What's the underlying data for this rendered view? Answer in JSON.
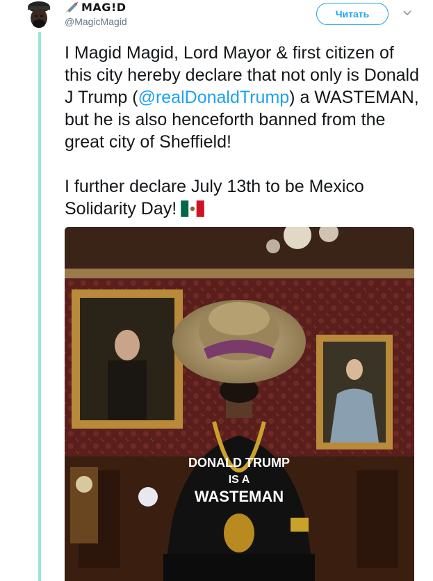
{
  "tweet": {
    "display_name": "MAG!D",
    "handle": "@MagicMagid",
    "follow_label": "Читать",
    "text_before_mention": "I Magid Magid, Lord Mayor & first citizen of this city hereby declare that not only is Donald J Trump (",
    "mention": "@realDonaldTrump",
    "text_after_mention": ") a WASTEMAN, but he is also henceforth banned from the great city of Sheffield!",
    "paragraph2": "I further declare July 13th to be Mexico Solidarity Day!",
    "flag_emoji": "mexico-flag-icon",
    "shirt_line1": "DONALD TRUMP",
    "shirt_line2": "IS A",
    "shirt_line3": "WASTEMAN"
  },
  "colors": {
    "accent": "#1da1f2",
    "thread_line": "#9be5d6",
    "text": "#14171a",
    "muted": "#657786"
  }
}
